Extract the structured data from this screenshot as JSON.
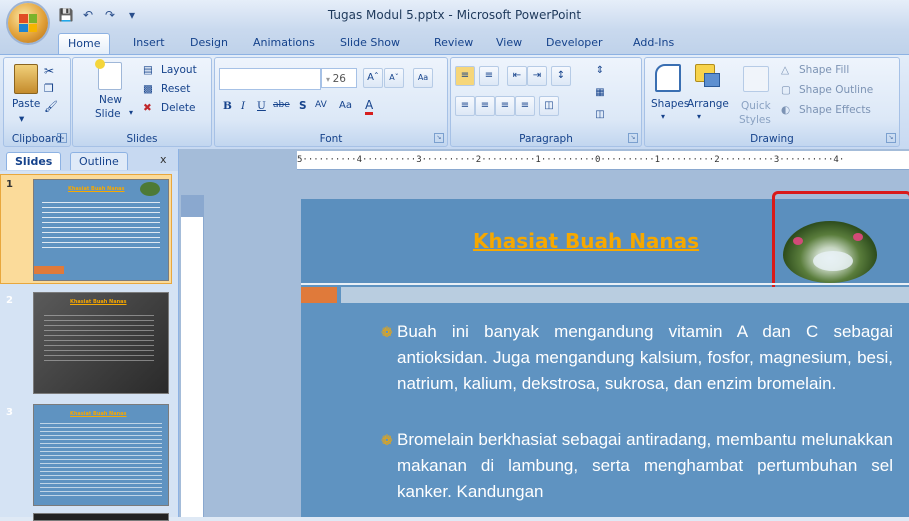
{
  "window": {
    "title": "Tugas Modul 5.pptx - Microsoft PowerPoint"
  },
  "qat": {
    "icons": [
      "save-icon",
      "undo-icon",
      "redo-icon",
      "customize-icon"
    ]
  },
  "tabs": [
    "Home",
    "Insert",
    "Design",
    "Animations",
    "Slide Show",
    "Review",
    "View",
    "Developer",
    "Add-Ins"
  ],
  "ribbon": {
    "clipboard": {
      "label": "Clipboard",
      "paste": "Paste"
    },
    "slides": {
      "label": "Slides",
      "new_slide_1": "New",
      "new_slide_2": "Slide",
      "layout": "Layout",
      "reset": "Reset",
      "delete": "Delete"
    },
    "font": {
      "label": "Font",
      "size": "26"
    },
    "paragraph": {
      "label": "Paragraph"
    },
    "drawing": {
      "label": "Drawing",
      "shapes": "Shapes",
      "arrange": "Arrange",
      "quick_styles_1": "Quick",
      "quick_styles_2": "Styles",
      "shape_fill": "Shape Fill",
      "shape_outline": "Shape Outline",
      "shape_effects": "Shape Effects"
    }
  },
  "pane": {
    "tab_slides": "Slides",
    "tab_outline": "Outline",
    "close": "x",
    "thumbs": [
      {
        "num": "1",
        "title": "Khasiat Buah Nanas"
      },
      {
        "num": "2",
        "title": "Khasiat Buah Nanas"
      },
      {
        "num": "3",
        "title": "Khasiat Buah Nanas"
      }
    ]
  },
  "ruler": {
    "text": "5··········4··········3··········2··········1··········0··········1··········2··········3··········4·"
  },
  "slide": {
    "title": "Khasiat Buah Nanas",
    "bullet1": "Buah ini banyak mengandung vitamin A dan C sebagai antioksidan. Juga mengandung kalsium, fosfor, magnesium, besi, natrium, kalium, dekstrosa, sukrosa, dan enzim bromelain.",
    "bullet2": "Bromelain berkhasiat sebagai antiradang, membantu melunakkan makanan di lambung, serta menghambat pertumbuhan sel kanker. Kandungan"
  },
  "colors": {
    "accent": "#f6a800",
    "slide_bg": "#5f93c1",
    "highlight": "#d91a1a"
  }
}
